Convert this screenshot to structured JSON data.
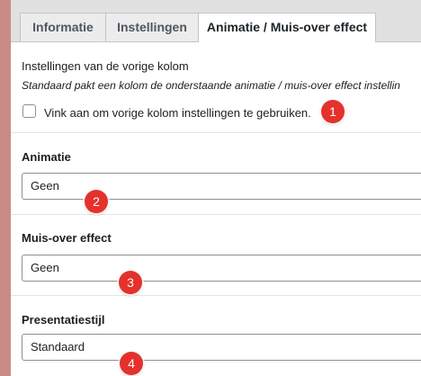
{
  "tabs": [
    {
      "label": "Informatie",
      "active": false
    },
    {
      "label": "Instellingen",
      "active": false
    },
    {
      "label": "Animatie / Muis-over effect",
      "active": true
    }
  ],
  "previous_column": {
    "title": "Instellingen van de vorige kolom",
    "description": "Standaard pakt een kolom de onderstaande animatie / muis-over effect instellin",
    "checkbox_label": "Vink aan om vorige kolom instellingen te gebruiken.",
    "checked": false,
    "marker": "1"
  },
  "animation": {
    "label": "Animatie",
    "value": "Geen",
    "marker": "2"
  },
  "hover_effect": {
    "label": "Muis-over effect",
    "value": "Geen",
    "marker": "3"
  },
  "presentation": {
    "label": "Presentatiestijl",
    "value": "Standaard",
    "marker": "4"
  },
  "colors": {
    "marker": "#e5312c",
    "left_strip": "#c98b86",
    "tabbar": "#e1e1e1"
  }
}
